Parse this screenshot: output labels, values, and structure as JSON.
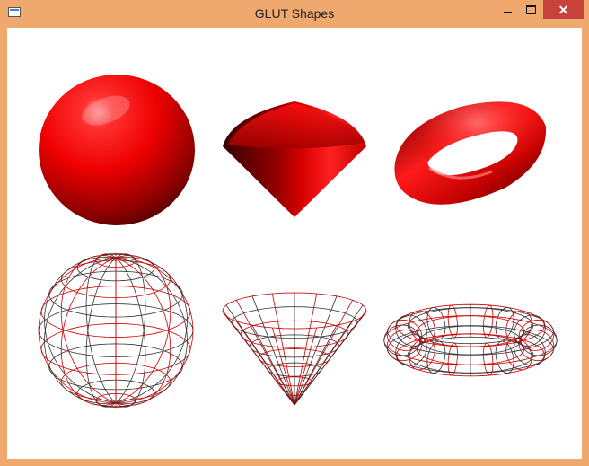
{
  "window": {
    "title": "GLUT Shapes",
    "controls": {
      "minimize_icon": "minimize-icon",
      "maximize_icon": "maximize-icon",
      "close_icon": "close-icon",
      "close_glyph": "✕"
    }
  },
  "scene": {
    "background": "#ffffff",
    "solid_color": "#ff0000",
    "wire_color": "#cc0000",
    "shapes": [
      {
        "kind": "solid-sphere"
      },
      {
        "kind": "solid-cone"
      },
      {
        "kind": "solid-torus"
      },
      {
        "kind": "wire-sphere"
      },
      {
        "kind": "wire-cone"
      },
      {
        "kind": "wire-torus"
      }
    ]
  }
}
